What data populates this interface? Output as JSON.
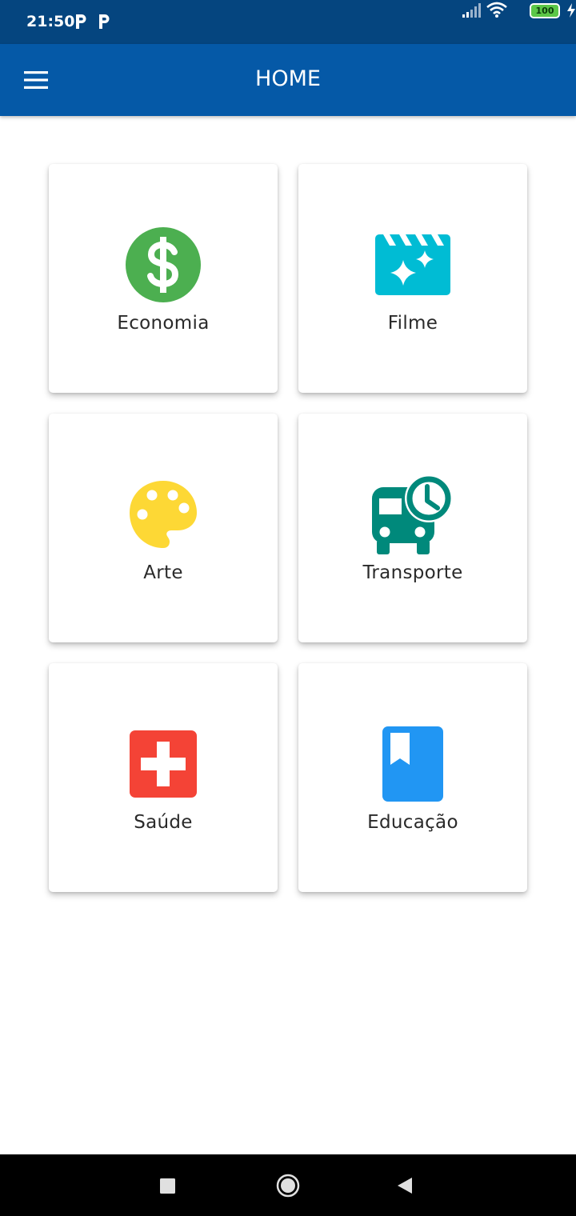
{
  "status_bar": {
    "time": "21:50",
    "notification_icons": [
      "p-icon",
      "p-icon"
    ],
    "signal_icon": "signal-icon",
    "wifi_icon": "wifi-icon",
    "battery_level": "100",
    "charging_icon": "bolt-icon"
  },
  "app_bar": {
    "title": "HOME",
    "menu_icon": "hamburger-icon",
    "background": "#0559a7"
  },
  "categories": [
    {
      "label": "Economia",
      "icon": "dollar-icon",
      "color": "#4caf50"
    },
    {
      "label": "Filme",
      "icon": "movie-clapper-icon",
      "color": "#00bcd4"
    },
    {
      "label": "Arte",
      "icon": "palette-icon",
      "color": "#fdd835"
    },
    {
      "label": "Transporte",
      "icon": "bus-clock-icon",
      "color": "#009688"
    },
    {
      "label": "Saúde",
      "icon": "medical-cross-icon",
      "color": "#f44336"
    },
    {
      "label": "Educação",
      "icon": "book-icon",
      "color": "#2196f3"
    }
  ],
  "nav_bar": {
    "buttons": [
      "recents-square-icon",
      "home-circle-icon",
      "back-triangle-icon"
    ]
  }
}
